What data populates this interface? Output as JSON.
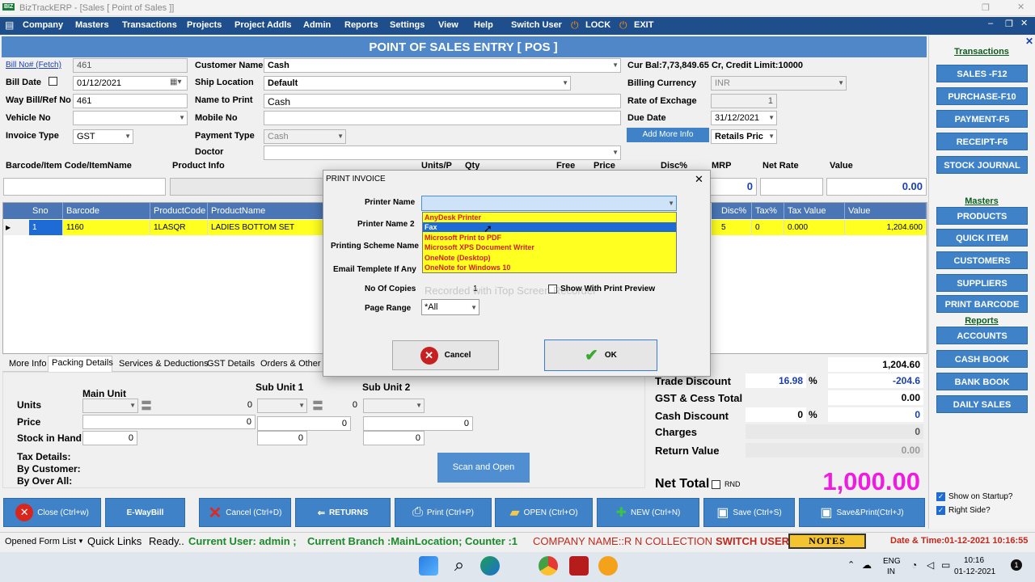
{
  "window": {
    "title": "BizTrackERP - [Sales [ Point of Sales ]]",
    "logo": "BIZ"
  },
  "menu": [
    "Company",
    "Masters",
    "Transactions",
    "Projects",
    "Project Addls",
    "Admin",
    "Reports",
    "Settings",
    "View",
    "Help",
    "Switch User",
    "LOCK",
    "EXIT"
  ],
  "page_title": "POINT OF SALES ENTRY [ POS ]",
  "form": {
    "bill_no_label": "Bill No# (Fetch)",
    "bill_no": "461",
    "bill_date_label": "Bill Date",
    "bill_date": "01/12/2021",
    "waybill_label": "Way Bill/Ref No",
    "waybill": "461",
    "vehicle_label": "Vehicle No",
    "invoice_type_label": "Invoice Type",
    "invoice_type": "GST",
    "customer_name_label": "Customer Name",
    "customer_name": "Cash",
    "ship_location_label": "Ship Location",
    "ship_location": "Default",
    "name_to_print_label": "Name to Print",
    "name_to_print": "Cash",
    "mobile_label": "Mobile No",
    "payment_type_label": "Payment Type",
    "payment_type": "Cash",
    "doctor_label": "Doctor",
    "cur_bal": "Cur Bal:7,73,849.65 Cr, Credit Limit:10000",
    "billing_currency_label": "Billing Currency",
    "billing_currency": "INR",
    "exchange_label": "Rate of Exchage",
    "exchange": "1",
    "due_date_label": "Due Date",
    "due_date": "31/12/2021",
    "add_more_info": "Add More Info",
    "price_type": "Retails Pric"
  },
  "item_entry": {
    "headers": [
      "Barcode/Item Code/ItemName",
      "Product Info",
      "Units/P",
      "Qty",
      "Free",
      "Price",
      "Disc%",
      "MRP",
      "Net Rate",
      "Value"
    ],
    "mrp_value": "0",
    "value": "0.00"
  },
  "grid": {
    "columns": [
      "Sno",
      "Barcode",
      "ProductCode",
      "ProductName",
      "Disc%",
      "Tax%",
      "Tax Value",
      "Value"
    ],
    "rows": [
      {
        "sno": "1",
        "barcode": "1160",
        "code": "1LASQR",
        "name": "LADIES BOTTOM SET",
        "disc": "5",
        "tax": "0",
        "taxval": "0.000",
        "value": "1,204.600"
      }
    ]
  },
  "dialog": {
    "title": "PRINT INVOICE",
    "printer_name_label": "Printer Name",
    "printer_name2_label": "Printer Name 2",
    "scheme_label": "Printing Scheme Name",
    "email_label": "Email Templete If Any",
    "copies_label": "No Of Copies",
    "copies": "1",
    "preview_label": "Show With Print Preview",
    "page_range_label": "Page Range",
    "page_range": "*All",
    "options": [
      "AnyDesk Printer",
      "Fax",
      "Microsoft Print to PDF",
      "Microsoft XPS Document Writer",
      "OneNote (Desktop)",
      "OneNote for Windows 10"
    ],
    "selected_index": 1,
    "cancel": "Cancel",
    "ok": "OK",
    "watermark": "Recorded with iTop Screen Recorder"
  },
  "tabs": [
    "More Info",
    "Packing Details",
    "Services & Deductions",
    "GST Details",
    "Orders & Other E"
  ],
  "packing": {
    "main_unit": "Main Unit",
    "sub_unit1": "Sub Unit 1",
    "sub_unit2": "Sub Unit 2",
    "units": "Units",
    "price": "Price",
    "stock": "Stock in Hand",
    "units_v1": "0",
    "units_v2": "0",
    "price_v1": "0",
    "price_v2": "0",
    "price_v3": "0",
    "stock_v1": "0",
    "stock_v2": "0",
    "stock_v3": "0",
    "tax_details": "Tax Details:",
    "by_customer": "By Customer:",
    "by_over_all": "By Over All:",
    "scan_open": "Scan and Open"
  },
  "totals": {
    "gross": "1,204.60",
    "trade_discount_label": "Trade Discount",
    "trade_pct": "16.98",
    "pct_sign": "%",
    "trade_value": "-204.6",
    "gst_label": "GST & Cess Total",
    "gst": "0.00",
    "cash_discount_label": "Cash Discount",
    "cash_pct": "0",
    "cash_pct_sign": "%",
    "cash_value": "0",
    "charges_label": "Charges",
    "charges": "0",
    "return_label": "Return Value",
    "return_value": "0.00",
    "net_total_label": "Net Total",
    "rnd": "RND",
    "net_total": "1,000.00"
  },
  "sidebar": {
    "transactions_hdr": "Transactions",
    "transactions": [
      "SALES -F12",
      "PURCHASE-F10",
      "PAYMENT-F5",
      "RECEIPT-F6",
      "STOCK JOURNAL"
    ],
    "masters_hdr": "Masters",
    "masters": [
      "PRODUCTS",
      "QUICK ITEM",
      "CUSTOMERS",
      "SUPPLIERS",
      "PRINT BARCODE"
    ],
    "reports_hdr": "Reports",
    "reports": [
      "ACCOUNTS",
      "CASH BOOK",
      "BANK BOOK",
      "DAILY SALES"
    ],
    "show_startup": "Show on Startup?",
    "right_side": "Right Side?"
  },
  "bottom_buttons": [
    "Close (Ctrl+w)",
    "E-WayBill",
    "Cancel (Ctrl+D)",
    "RETURNS",
    "Print (Ctrl+P)",
    "OPEN (Ctrl+O)",
    "NEW (Ctrl+N)",
    "Save (Ctrl+S)",
    "Save&Print(Ctrl+J)"
  ],
  "status": {
    "opened_form": "Opened Form List",
    "quick_links": "Quick Links",
    "ready": "Ready..",
    "user": "Current User: admin ;",
    "branch": "Current Branch :MainLocation; Counter :1",
    "company": "COMPANY NAME::R N COLLECTION",
    "switch_user": "SWITCH USER",
    "notes": "NOTES",
    "datetime": "Date & Time:01-12-2021 10:16:55"
  },
  "taskbar": {
    "lang1": "ENG",
    "lang2": "IN",
    "time": "10:16",
    "date": "01-12-2021",
    "badge": "1"
  }
}
